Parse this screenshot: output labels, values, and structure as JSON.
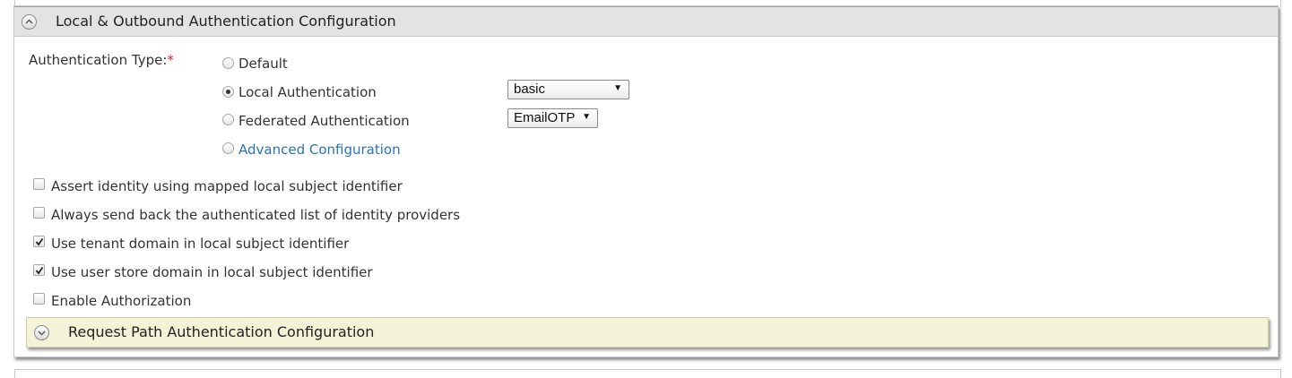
{
  "section": {
    "title": "Local & Outbound Authentication Configuration",
    "toggle_icon": "chevron-up-icon"
  },
  "auth_type": {
    "label": "Authentication Type:",
    "required_mark": "*",
    "options": [
      {
        "label": "Default",
        "selected": false
      },
      {
        "label": "Local Authentication",
        "selected": true
      },
      {
        "label": "Federated Authentication",
        "selected": false
      },
      {
        "label": "Advanced Configuration",
        "selected": false
      }
    ],
    "local_select_value": "basic",
    "federated_select_value": "EmailOTP"
  },
  "checkboxes": [
    {
      "label": "Assert identity using mapped local subject identifier",
      "checked": false
    },
    {
      "label": "Always send back the authenticated list of identity providers",
      "checked": false
    },
    {
      "label": "Use tenant domain in local subject identifier",
      "checked": true
    },
    {
      "label": "Use user store domain in local subject identifier",
      "checked": true
    },
    {
      "label": "Enable Authorization",
      "checked": false
    }
  ],
  "request_path": {
    "title": "Request Path Authentication Configuration",
    "toggle_icon": "chevron-down-icon"
  },
  "colors": {
    "header_bg": "#e3e3e3",
    "subpanel_bg": "#f4f3d8",
    "link": "#2a73b8",
    "required": "#d9251d"
  }
}
